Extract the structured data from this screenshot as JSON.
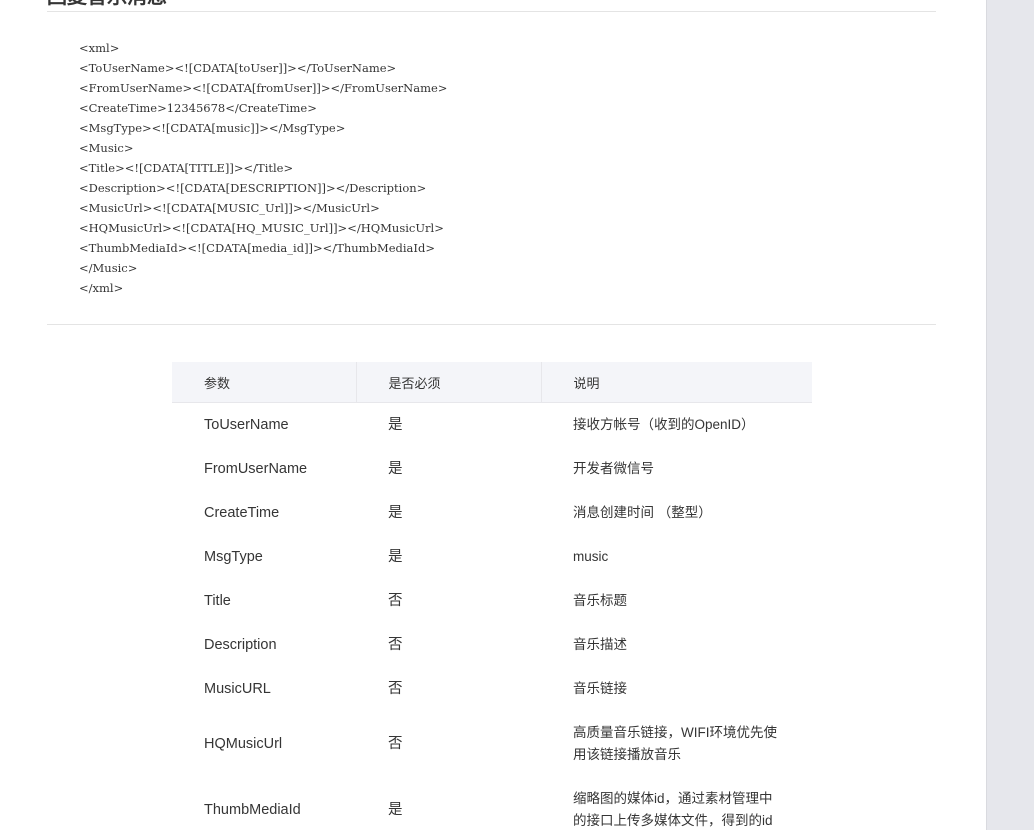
{
  "heading": "回复音乐消息",
  "code_lines": [
    "<xml>",
    "<ToUserName><![CDATA[toUser]]></ToUserName>",
    "<FromUserName><![CDATA[fromUser]]></FromUserName>",
    "<CreateTime>12345678</CreateTime>",
    "<MsgType><![CDATA[music]]></MsgType>",
    "<Music>",
    "<Title><![CDATA[TITLE]]></Title>",
    "<Description><![CDATA[DESCRIPTION]]></Description>",
    "<MusicUrl><![CDATA[MUSIC_Url]]></MusicUrl>",
    "<HQMusicUrl><![CDATA[HQ_MUSIC_Url]]></HQMusicUrl>",
    "<ThumbMediaId><![CDATA[media_id]]></ThumbMediaId>",
    "</Music>",
    "</xml>"
  ],
  "table": {
    "headers": [
      "参数",
      "是否必须",
      "说明"
    ],
    "rows": [
      {
        "param": "ToUserName",
        "required": "是",
        "desc": "接收方帐号（收到的OpenID）"
      },
      {
        "param": "FromUserName",
        "required": "是",
        "desc": "开发者微信号"
      },
      {
        "param": "CreateTime",
        "required": "是",
        "desc": "消息创建时间 （整型）"
      },
      {
        "param": "MsgType",
        "required": "是",
        "desc": "music"
      },
      {
        "param": "Title",
        "required": "否",
        "desc": "音乐标题"
      },
      {
        "param": "Description",
        "required": "否",
        "desc": "音乐描述"
      },
      {
        "param": "MusicURL",
        "required": "否",
        "desc": "音乐链接"
      },
      {
        "param": "HQMusicUrl",
        "required": "否",
        "desc": "高质量音乐链接，WIFI环境优先使用该链接播放音乐"
      },
      {
        "param": "ThumbMediaId",
        "required": "是",
        "desc": "缩略图的媒体id，通过素材管理中的接口上传多媒体文件，得到的id"
      }
    ]
  }
}
